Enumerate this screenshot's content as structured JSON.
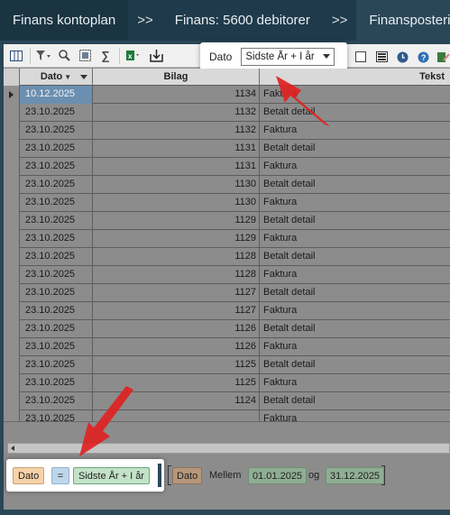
{
  "breadcrumbs": {
    "item1": "Finans kontoplan",
    "sep1": ">>",
    "item2": "Finans: 5600 debitorer",
    "sep2": ">>",
    "item3": "Finansposteringer"
  },
  "toolbar": {
    "date_label": "Dato",
    "period_select": "Sidste År + I år"
  },
  "table": {
    "columns": [
      "Dato",
      "Bilag",
      "Tekst"
    ],
    "rows": [
      {
        "dato": "10.12.2025",
        "bilag": "1134",
        "tekst": "Faktura"
      },
      {
        "dato": "23.10.2025",
        "bilag": "1132",
        "tekst": "Betalt detail"
      },
      {
        "dato": "23.10.2025",
        "bilag": "1132",
        "tekst": "Faktura"
      },
      {
        "dato": "23.10.2025",
        "bilag": "1131",
        "tekst": "Betalt detail"
      },
      {
        "dato": "23.10.2025",
        "bilag": "1131",
        "tekst": "Faktura"
      },
      {
        "dato": "23.10.2025",
        "bilag": "1130",
        "tekst": "Betalt detail"
      },
      {
        "dato": "23.10.2025",
        "bilag": "1130",
        "tekst": "Faktura"
      },
      {
        "dato": "23.10.2025",
        "bilag": "1129",
        "tekst": "Betalt detail"
      },
      {
        "dato": "23.10.2025",
        "bilag": "1129",
        "tekst": "Faktura"
      },
      {
        "dato": "23.10.2025",
        "bilag": "1128",
        "tekst": "Betalt detail"
      },
      {
        "dato": "23.10.2025",
        "bilag": "1128",
        "tekst": "Faktura"
      },
      {
        "dato": "23.10.2025",
        "bilag": "1127",
        "tekst": "Betalt detail"
      },
      {
        "dato": "23.10.2025",
        "bilag": "1127",
        "tekst": "Faktura"
      },
      {
        "dato": "23.10.2025",
        "bilag": "1126",
        "tekst": "Betalt detail"
      },
      {
        "dato": "23.10.2025",
        "bilag": "1126",
        "tekst": "Faktura"
      },
      {
        "dato": "23.10.2025",
        "bilag": "1125",
        "tekst": "Betalt detail"
      },
      {
        "dato": "23.10.2025",
        "bilag": "1125",
        "tekst": "Faktura"
      },
      {
        "dato": "23.10.2025",
        "bilag": "1124",
        "tekst": "Betalt detail"
      },
      {
        "dato": "23.10.2025",
        "bilag": "",
        "tekst": "Faktura"
      }
    ]
  },
  "filter": {
    "field": "Dato",
    "operator": "=",
    "value": "Sidste År + I år",
    "expanded_field": "Dato",
    "expanded_op": "Mellem",
    "from": "01.01.2025",
    "and_label": "og",
    "to": "31.12.2025"
  },
  "icons": [
    "grid-layout-icon",
    "filter-icon",
    "search-icon",
    "select-icon",
    "sum-icon",
    "excel-icon",
    "export-icon"
  ],
  "colors": {
    "header_bar": "#1f3a4a",
    "selected_cell": "#6b8fb0",
    "arrow": "#e02020"
  }
}
